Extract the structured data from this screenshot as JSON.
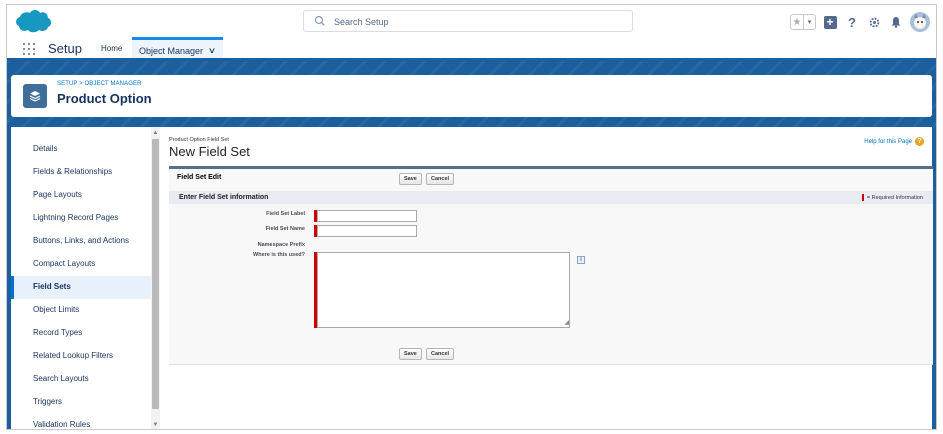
{
  "header": {
    "logo": "salesforce-cloud-logo",
    "search_placeholder": "Search Setup",
    "icons": [
      "star-icon",
      "chevron-down-icon",
      "plus-icon",
      "question-icon",
      "gear-icon",
      "bell-icon",
      "avatar"
    ]
  },
  "context_bar": {
    "app_name": "Setup",
    "tabs": [
      {
        "label": "Home"
      },
      {
        "label": "Object Manager",
        "active": true
      }
    ]
  },
  "banner": {
    "breadcrumb": "SETUP > OBJECT MANAGER",
    "title": "Product Option"
  },
  "sidebar": {
    "items": [
      {
        "label": "Details"
      },
      {
        "label": "Fields & Relationships"
      },
      {
        "label": "Page Layouts"
      },
      {
        "label": "Lightning Record Pages"
      },
      {
        "label": "Buttons, Links, and Actions"
      },
      {
        "label": "Compact Layouts"
      },
      {
        "label": "Field Sets",
        "active": true
      },
      {
        "label": "Object Limits"
      },
      {
        "label": "Record Types"
      },
      {
        "label": "Related Lookup Filters"
      },
      {
        "label": "Search Layouts"
      },
      {
        "label": "Triggers"
      },
      {
        "label": "Validation Rules"
      }
    ]
  },
  "content": {
    "subtitle": "Product Option Field Set",
    "title": "New Field Set",
    "help_link": "Help for this Page",
    "block_title": "Field Set Edit",
    "save_label": "Save",
    "cancel_label": "Cancel",
    "section_title": "Enter Field Set information",
    "required_legend": "= Required Information",
    "fields": {
      "label_label": "Field Set Label",
      "label_value": "",
      "name_label": "Field Set Name",
      "name_value": "",
      "namespace_label": "Namespace Prefix",
      "where_label": "Where is this used?",
      "where_value": ""
    }
  },
  "colors": {
    "brand_blue": "#1b5f9e",
    "link_blue": "#0070d2",
    "required_red": "#c00000",
    "text_dark": "#16325c"
  }
}
